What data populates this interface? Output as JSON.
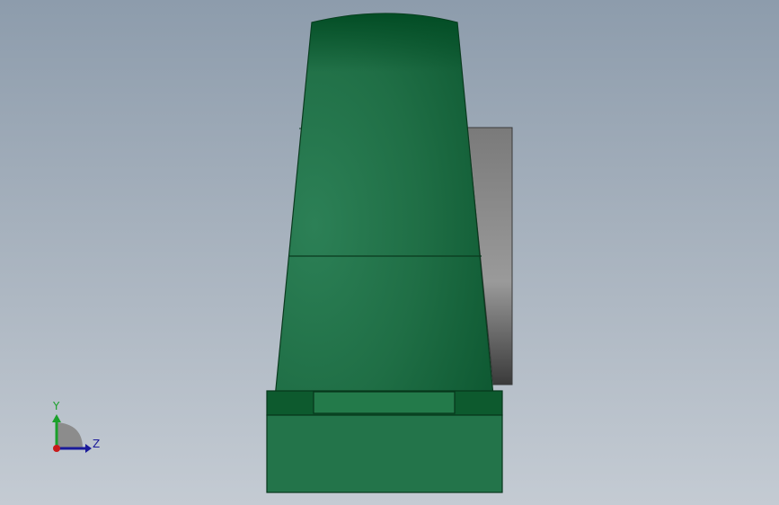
{
  "viewport": {
    "background_top": "#8d9cac",
    "background_bottom": "#c4cbd3"
  },
  "model": {
    "body_color": "#2a7a50",
    "body_dark_color": "#0a5a30",
    "side_plate_color": "#7a7a7a",
    "base_color": "#217346",
    "base_edge_color": "#0c4a24"
  },
  "triad": {
    "y_label": "Y",
    "z_label": "Z",
    "y_color": "#1aa02a",
    "z_color": "#1a1a9a",
    "origin_color": "#c81a1a"
  }
}
